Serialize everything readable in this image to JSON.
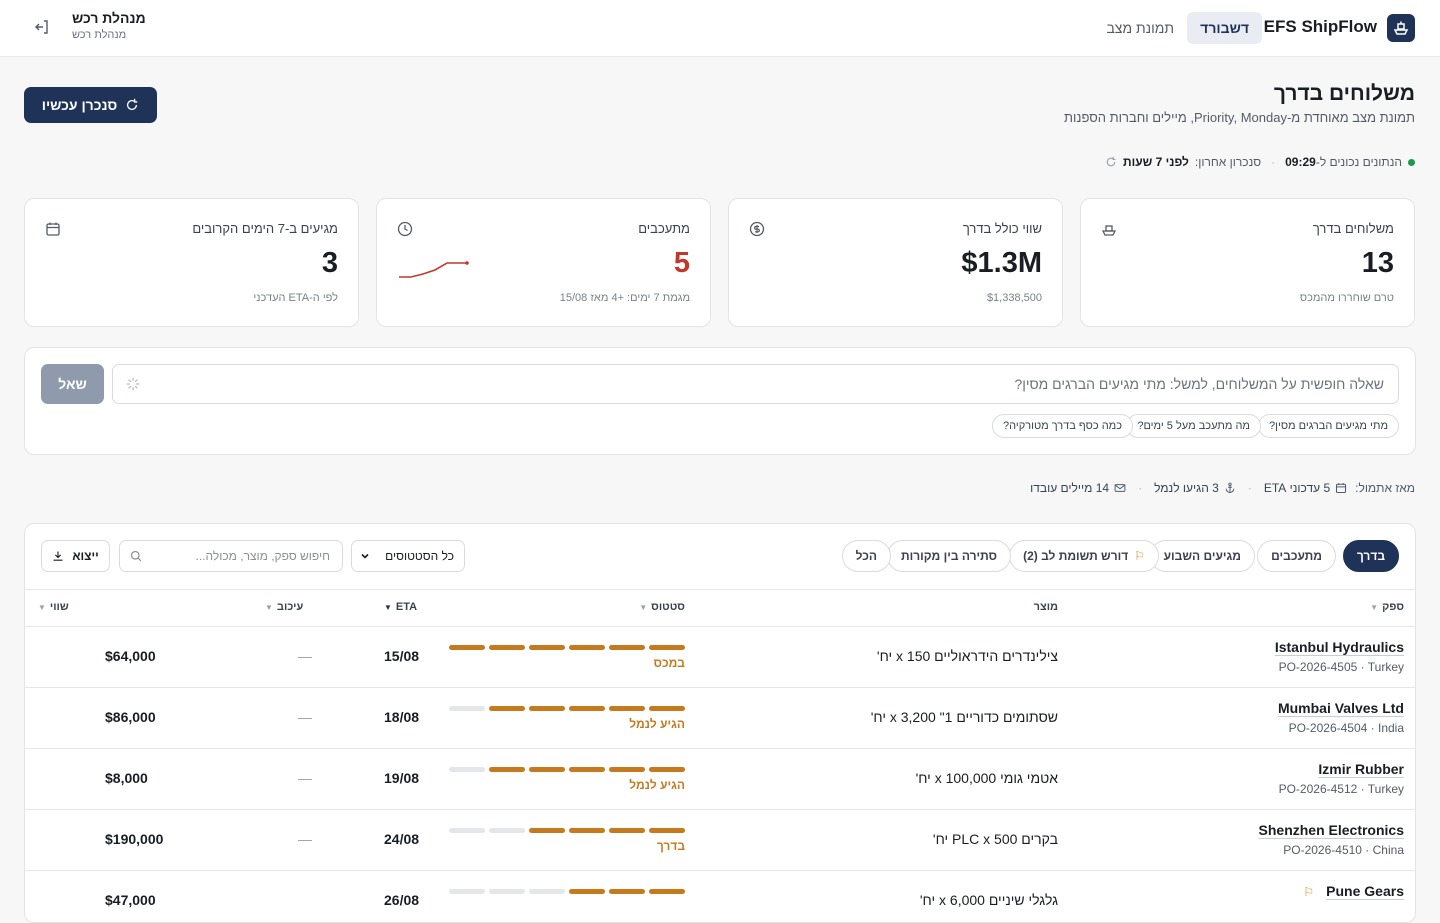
{
  "topbar": {
    "brand": "EFS ShipFlow",
    "tabs": [
      {
        "label": "דשבורד",
        "active": true
      },
      {
        "label": "תמונת מצב",
        "active": false
      }
    ],
    "user_name": "מנהלת רכש",
    "user_role": "מנהלת רכש",
    "logout_icon": "logout-icon",
    "logo_icon": "ship-icon"
  },
  "header": {
    "title": "משלוחים בדרך",
    "subtitle": "תמונת מצב מאוחדת מ-Priority, Monday, מיילים וחברות הספנות",
    "sync_button": "סנכרן עכשיו"
  },
  "status": {
    "data_correct_label": "הנתונים נכונים ל-",
    "data_time": "09:29",
    "last_sync_label": "סנכרון אחרון:",
    "last_sync_value": "לפני 7 שעות",
    "live_color": "#1a9a4a"
  },
  "kpis": [
    {
      "title": "משלוחים בדרך",
      "value": "13",
      "foot": "טרם שוחררו מהמכס",
      "icon": "ship-icon"
    },
    {
      "title": "שווי כולל בדרך",
      "value": "$1.3M",
      "foot": "$1,338,500",
      "icon": "dollar-icon"
    },
    {
      "title": "מתעכבים",
      "value": "5",
      "foot": "מגמת 7 ימים: +4 מאז 15/08",
      "icon": "clock-icon",
      "accent": "#c0392b"
    },
    {
      "title": "מגיעים ב-7 הימים הקרובים",
      "value": "3",
      "foot": "לפי ה-ETA העדכני",
      "icon": "calendar-icon"
    }
  ],
  "ask": {
    "placeholder": "שאלה חופשית על המשלוחים, למשל: מתי מגיעים הברגים מסין?",
    "button": "שאל",
    "chips": [
      "מתי מגיעים הברגים מסין?",
      "מה מתעכב מעל 5 ימים?",
      "כמה כסף בדרך מטורקיה?"
    ]
  },
  "since": {
    "label": "מאז אתמול:",
    "eta_updates": "5 עדכוני ETA",
    "arrived_port": "3 הגיעו לנמל",
    "emails": "14 מיילים עובדו"
  },
  "filters": {
    "chips": [
      {
        "label": "בדרך",
        "active": true
      },
      {
        "label": "מתעכבים",
        "active": false
      },
      {
        "label": "מגיעים השבוע",
        "active": false
      },
      {
        "label": "דורש תשומת לב (2)",
        "active": false
      },
      {
        "label": "סתירה בין מקורות",
        "active": false
      },
      {
        "label": "הכל",
        "active": false
      }
    ],
    "status_select": "כל הסטטוסים",
    "search_placeholder": "חיפוש ספק, מוצר, מכולה...",
    "export": "ייצוא"
  },
  "table": {
    "headers": {
      "supplier": "ספק",
      "product": "מוצר",
      "status": "סטטוס",
      "eta": "ETA",
      "delay": "עיכוב",
      "value": "שווי"
    },
    "rows": [
      {
        "supplier": "Istanbul Hydraulics",
        "meta": "PO-2026-4505 · Turkey",
        "product": "צילינדרים הידראוליים 150 x יח'",
        "stage": 6,
        "status": "במכס",
        "eta": "15/08",
        "delay": "—",
        "value": "$64,000",
        "flag": false
      },
      {
        "supplier": "Mumbai Valves Ltd",
        "meta": "PO-2026-4504 · India",
        "product": "שסתומים כדוריים 1\" 3,200 x יח'",
        "stage": 5,
        "status": "הגיע לנמל",
        "eta": "18/08",
        "delay": "—",
        "value": "$86,000",
        "flag": false
      },
      {
        "supplier": "Izmir Rubber",
        "meta": "PO-2026-4512 · Turkey",
        "product": "אטמי גומי 100,000 x יח'",
        "stage": 5,
        "status": "הגיע לנמל",
        "eta": "19/08",
        "delay": "—",
        "value": "$8,000",
        "flag": false
      },
      {
        "supplier": "Shenzhen Electronics",
        "meta": "PO-2026-4510 · China",
        "product": "בקרים PLC x 500 יח'",
        "stage": 4,
        "status": "בדרך",
        "eta": "24/08",
        "delay": "—",
        "value": "$190,000",
        "flag": false
      },
      {
        "supplier": "Pune Gears",
        "meta": "",
        "product": "גלגלי שיניים 6,000 x יח'",
        "stage": 3,
        "status": "",
        "eta": "26/08",
        "delay": "",
        "value": "$47,000",
        "flag": true
      }
    ]
  }
}
